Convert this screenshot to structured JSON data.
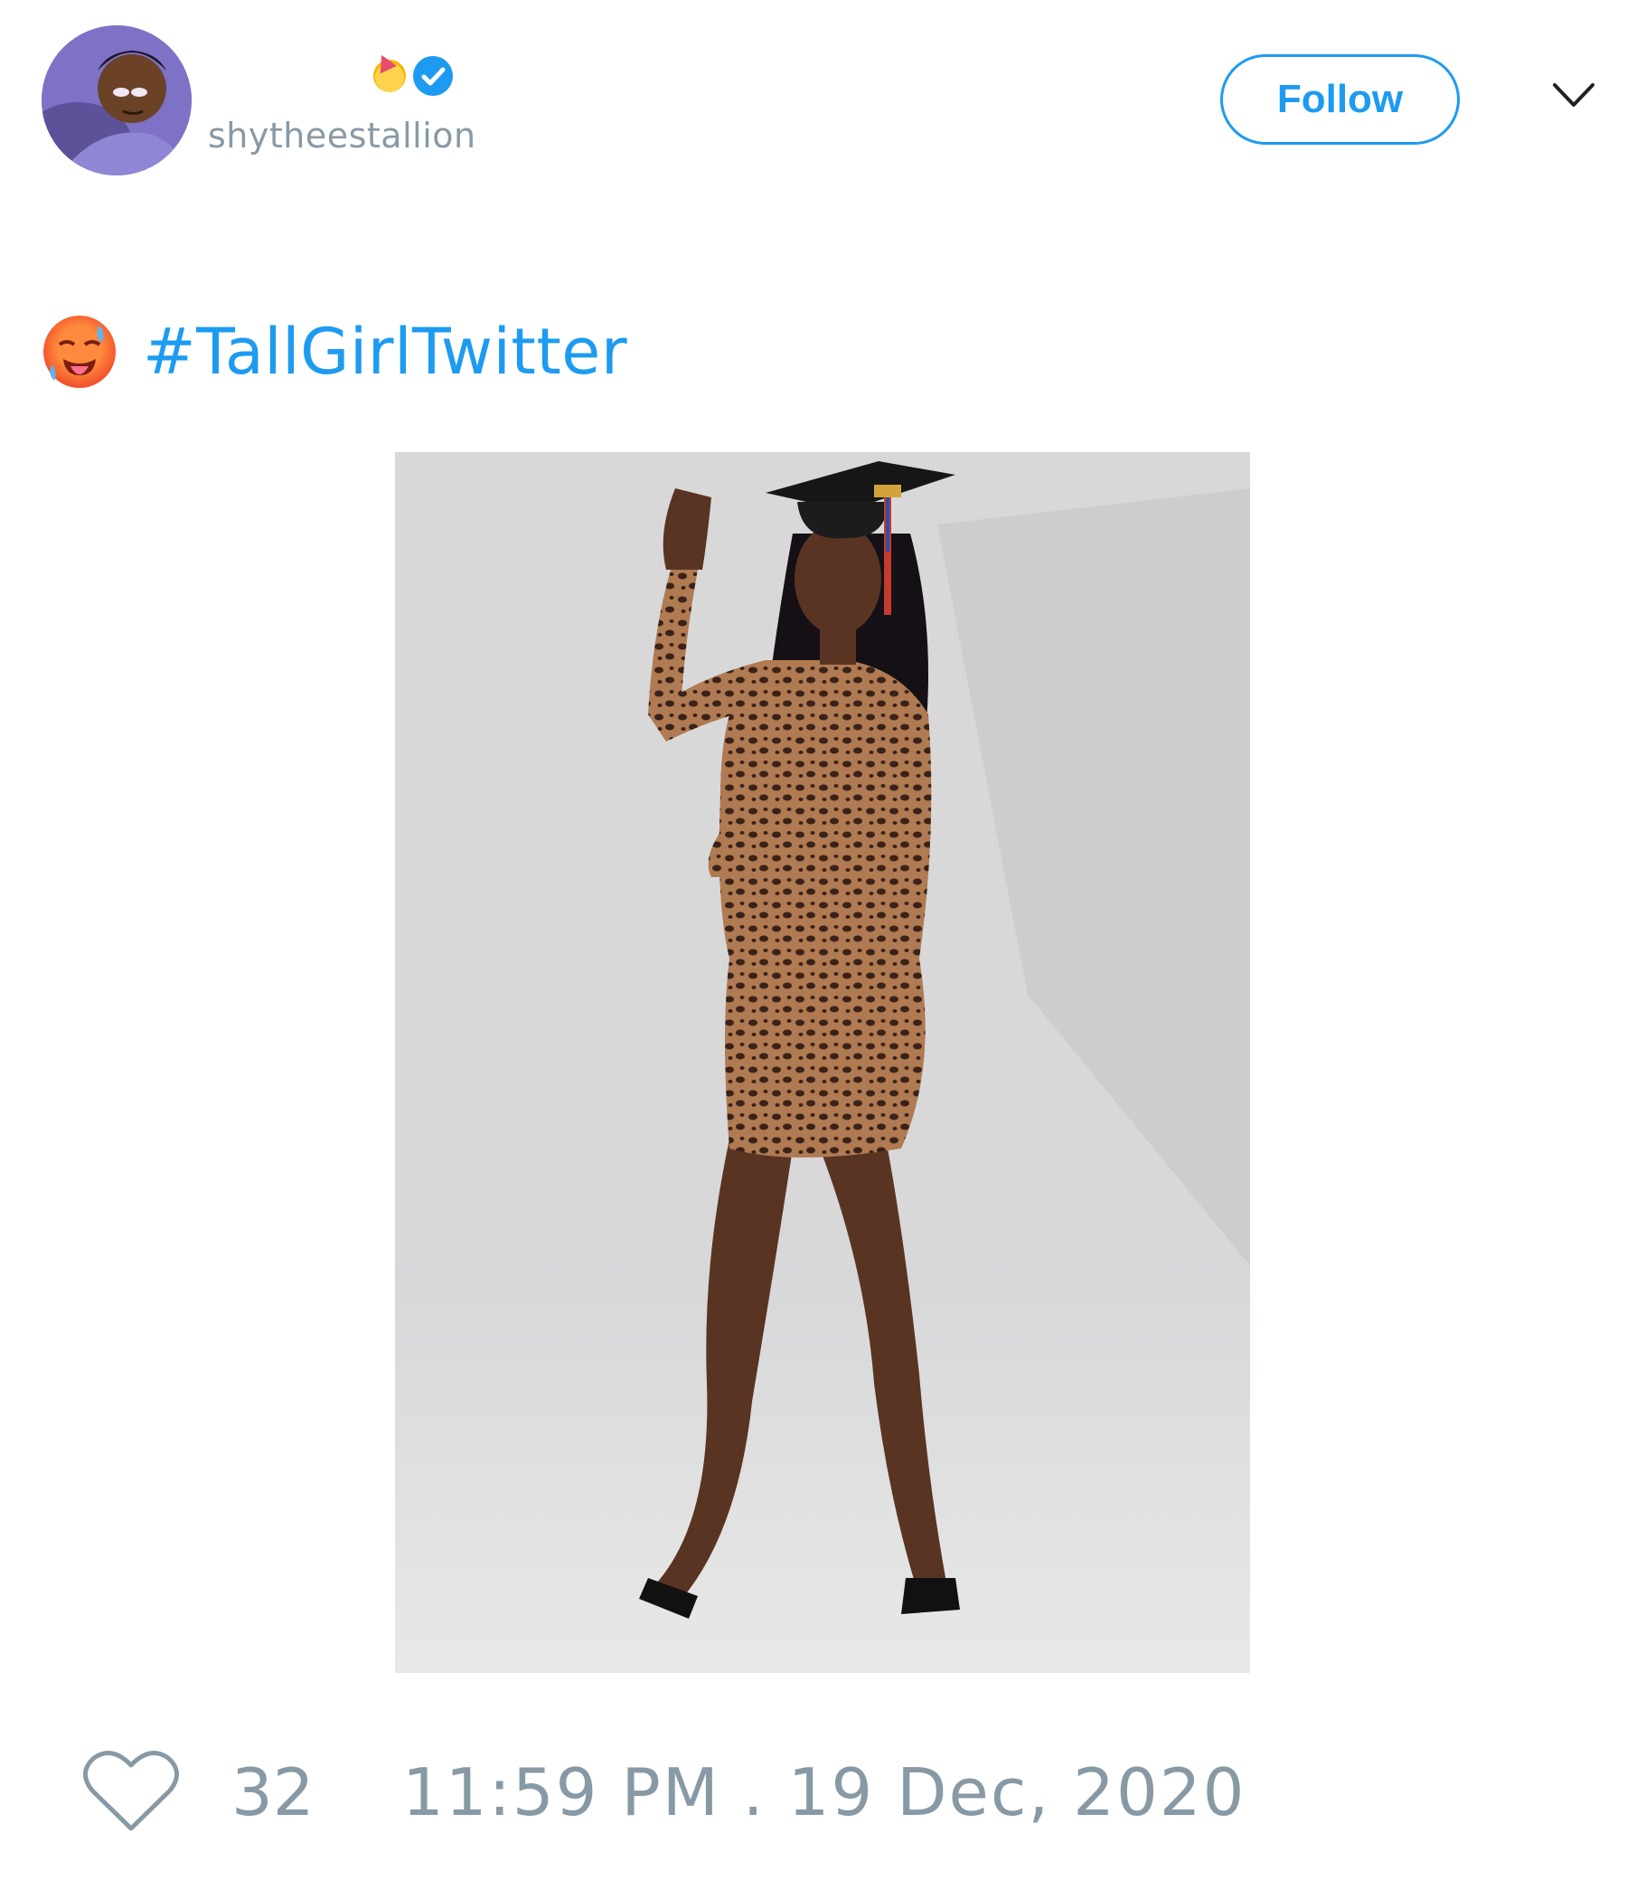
{
  "author": {
    "display_name": "",
    "handle": "shytheestallion",
    "avatar_icon": "cartoon-avatar",
    "name_emoji_icon": "partying-face-emoji-icon",
    "verified_icon": "verified-badge-icon"
  },
  "header": {
    "follow_label": "Follow",
    "menu_icon": "chevron-down-icon"
  },
  "tweet": {
    "emoji_icon": "hot-face-emoji-icon",
    "hashtag": "#TallGirlTwitter",
    "media_icon": "photo"
  },
  "footer": {
    "like_icon": "heart-icon",
    "like_count": "32",
    "timestamp": "11:59 PM . 19 Dec, 2020"
  },
  "colors": {
    "accent": "#1d9bf0",
    "muted": "#8899a6",
    "background": "#ffffff"
  }
}
